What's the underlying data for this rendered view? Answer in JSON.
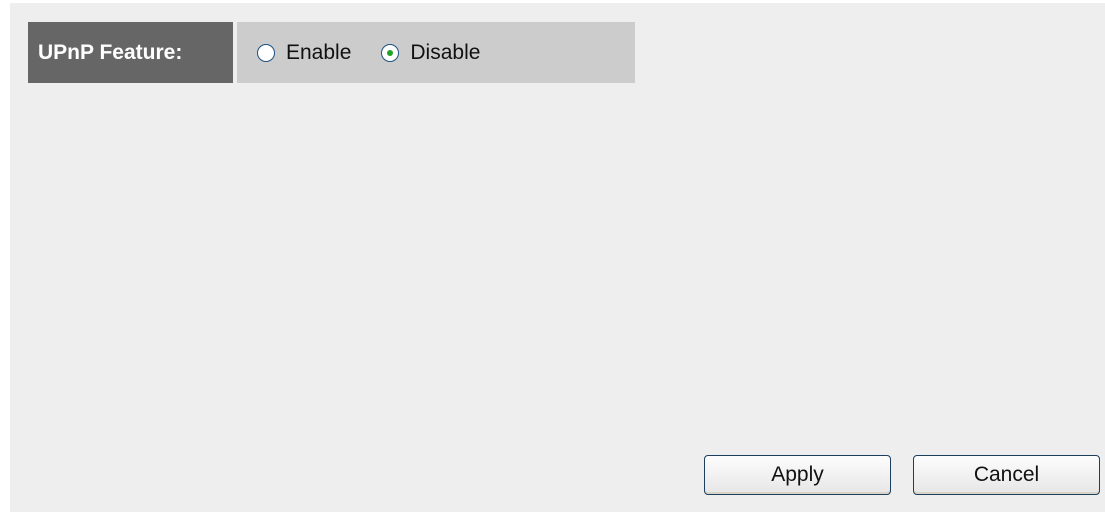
{
  "upnp": {
    "label": "UPnP Feature:",
    "options": [
      {
        "label": "Enable",
        "selected": false
      },
      {
        "label": "Disable",
        "selected": true
      }
    ]
  },
  "buttons": {
    "apply_label": "Apply",
    "cancel_label": "Cancel"
  },
  "colors": {
    "label_bg": "#666666",
    "options_bg": "#cccccc",
    "page_bg": "#eeeeee",
    "radio_selected_dot": "#21a121"
  }
}
